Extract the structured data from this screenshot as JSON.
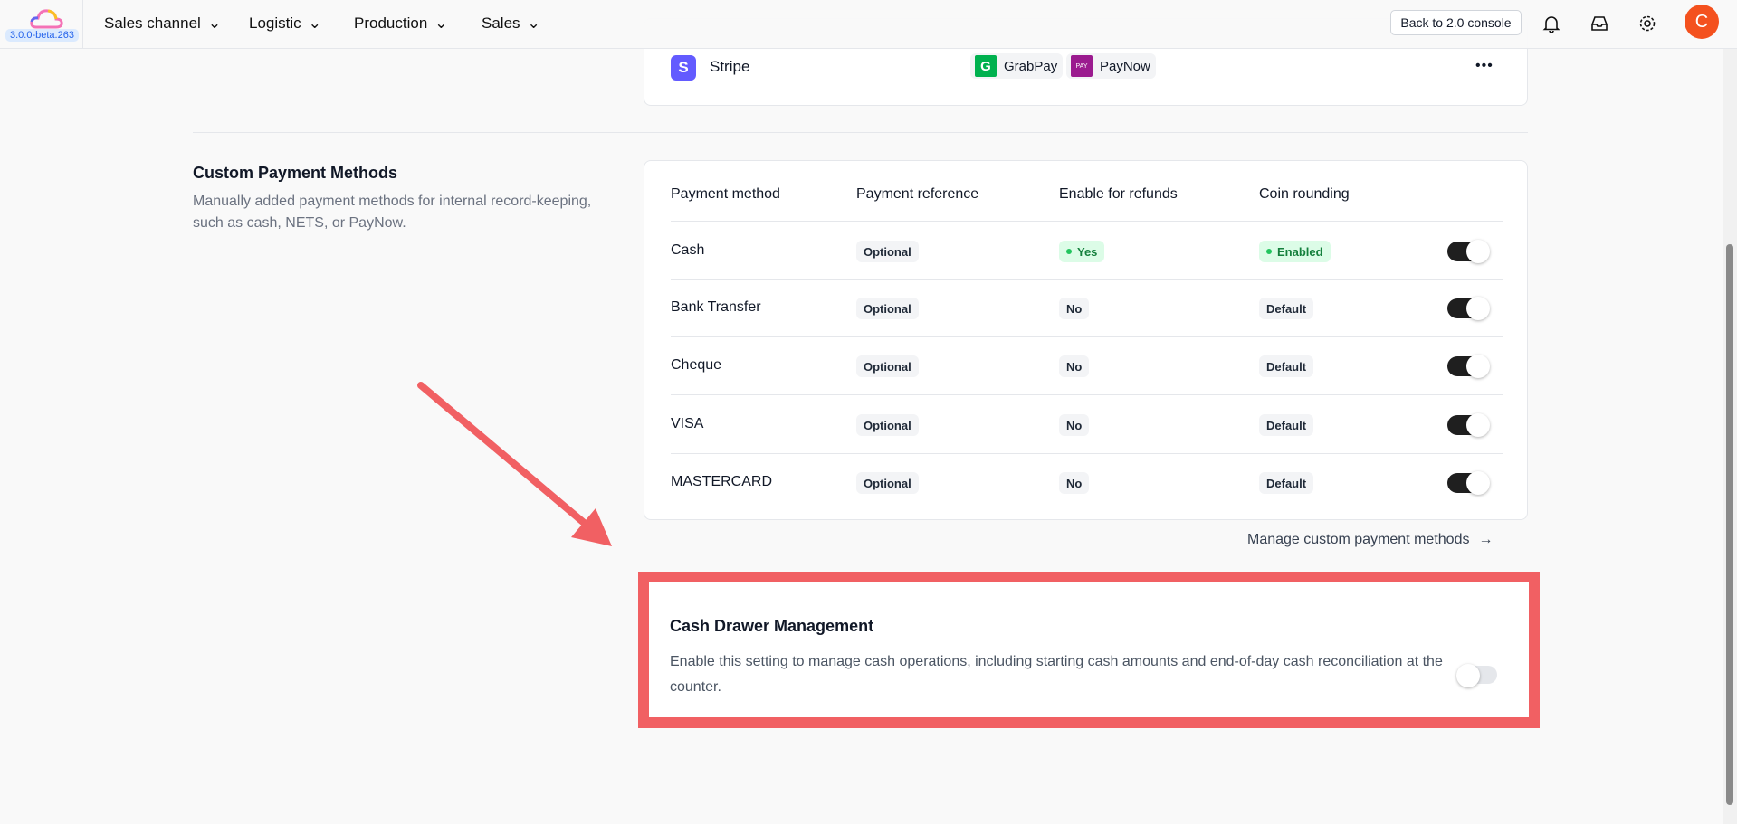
{
  "header": {
    "version": "3.0.0-beta.263",
    "nav": [
      "Sales channel",
      "Logistic",
      "Production",
      "Sales"
    ],
    "back_button": "Back to 2.0 console",
    "avatar_initial": "C"
  },
  "providers": {
    "name": "Stripe",
    "methods": [
      "GrabPay",
      "PayNow"
    ]
  },
  "custom": {
    "title": "Custom Payment Methods",
    "description": "Manually added payment methods for internal record-keeping, such as cash, NETS, or PayNow.",
    "columns": [
      "Payment method",
      "Payment reference",
      "Enable for refunds",
      "Coin rounding"
    ],
    "rows": [
      {
        "method": "Cash",
        "reference": "Optional",
        "refunds": "Yes",
        "rounding": "Enabled",
        "enabled": true
      },
      {
        "method": "Bank Transfer",
        "reference": "Optional",
        "refunds": "No",
        "rounding": "Default",
        "enabled": true
      },
      {
        "method": "Cheque",
        "reference": "Optional",
        "refunds": "No",
        "rounding": "Default",
        "enabled": true
      },
      {
        "method": "VISA",
        "reference": "Optional",
        "refunds": "No",
        "rounding": "Default",
        "enabled": true
      },
      {
        "method": "MASTERCARD",
        "reference": "Optional",
        "refunds": "No",
        "rounding": "Default",
        "enabled": true
      }
    ],
    "manage_link": "Manage custom payment methods"
  },
  "cash_drawer": {
    "title": "Cash Drawer Management",
    "description": "Enable this setting to manage cash operations, including starting cash amounts and end-of-day cash reconciliation at the counter.",
    "enabled": false
  },
  "colors": {
    "highlight": "#f16063",
    "avatar": "#f4511e",
    "stripe": "#635bff",
    "grabpay": "#00b14f",
    "paynow": "#9b1b8f"
  }
}
